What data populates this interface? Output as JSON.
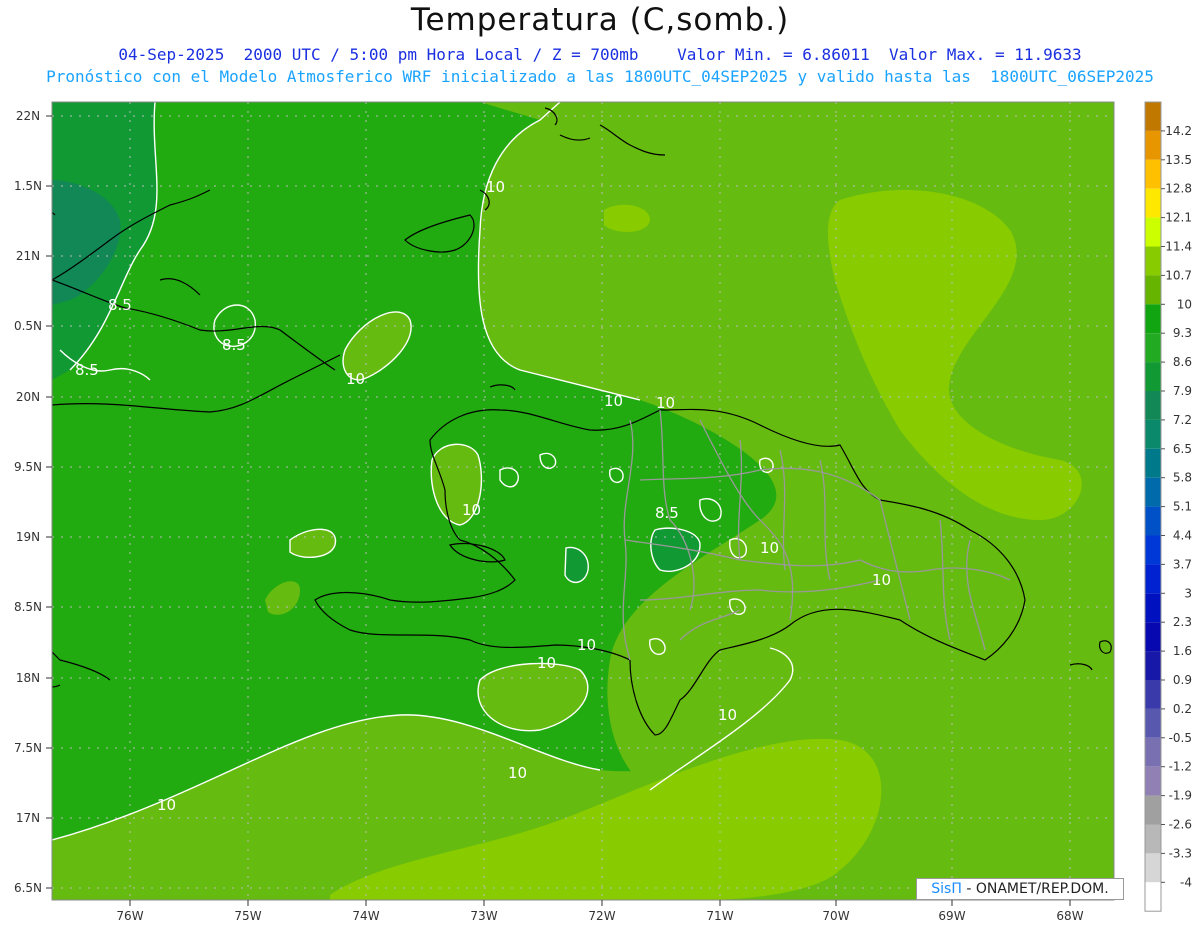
{
  "header": {
    "title": "Temperatura (C,somb.)",
    "line1": "04-Sep-2025  2000 UTC / 5:00 pm Hora Local / Z = 700mb    Valor Min. = 6.86011  Valor Max. = 11.9633",
    "line2": "Pronóstico con el Modelo Atmosferico WRF inicializado a las 1800UTC_04SEP2025 y valido hasta las  1800UTC_06SEP2025"
  },
  "map": {
    "lat_labels": [
      "22N",
      "1.5N",
      "21N",
      "0.5N",
      "20N",
      "9.5N",
      "19N",
      "8.5N",
      "18N",
      "7.5N",
      "17N",
      "6.5N"
    ],
    "lon_labels": [
      "76W",
      "75W",
      "74W",
      "73W",
      "72W",
      "71W",
      "70W",
      "69W",
      "68W"
    ],
    "contour_labels": [
      "8.5",
      "8.5",
      "8.5",
      "8.5",
      "10",
      "10",
      "10",
      "10",
      "10",
      "10",
      "10",
      "10",
      "10",
      "10",
      "10"
    ],
    "colors": {
      "base": "#22aa11",
      "warm": "#66bb11",
      "warmer": "#88cc00",
      "cool": "#119933",
      "coolest": "#118855",
      "coast": "#000000",
      "provinces": "#999999",
      "contour": "#ffffff"
    }
  },
  "colorbar": {
    "labels": [
      "14.2",
      "13.5",
      "12.8",
      "12.1",
      "11.4",
      "10.7",
      "10",
      "9.3",
      "8.6",
      "7.9",
      "7.2",
      "6.5",
      "5.8",
      "5.1",
      "4.4",
      "3.7",
      "3",
      "2.3",
      "1.6",
      "0.9",
      "0.2",
      "-0.5",
      "-1.2",
      "-1.9",
      "-2.6",
      "-3.3",
      "-4"
    ],
    "colors": [
      "#c07800",
      "#e89600",
      "#ffc000",
      "#ffe800",
      "#ccff00",
      "#88cc00",
      "#66b300",
      "#11a611",
      "#22aa22",
      "#119933",
      "#118855",
      "#0a8a6a",
      "#007a8a",
      "#006aaa",
      "#0050c8",
      "#0038d8",
      "#0022d0",
      "#0012c0",
      "#0808b0",
      "#1818a8",
      "#3a3aaa",
      "#5858ae",
      "#7870b0",
      "#9080b4",
      "#a0a0a0",
      "#b8b8b8",
      "#d6d6d6",
      "#ffffff"
    ]
  },
  "credit": {
    "brand": "SisΠ",
    "text": " - ONAMET/REP.DOM."
  }
}
